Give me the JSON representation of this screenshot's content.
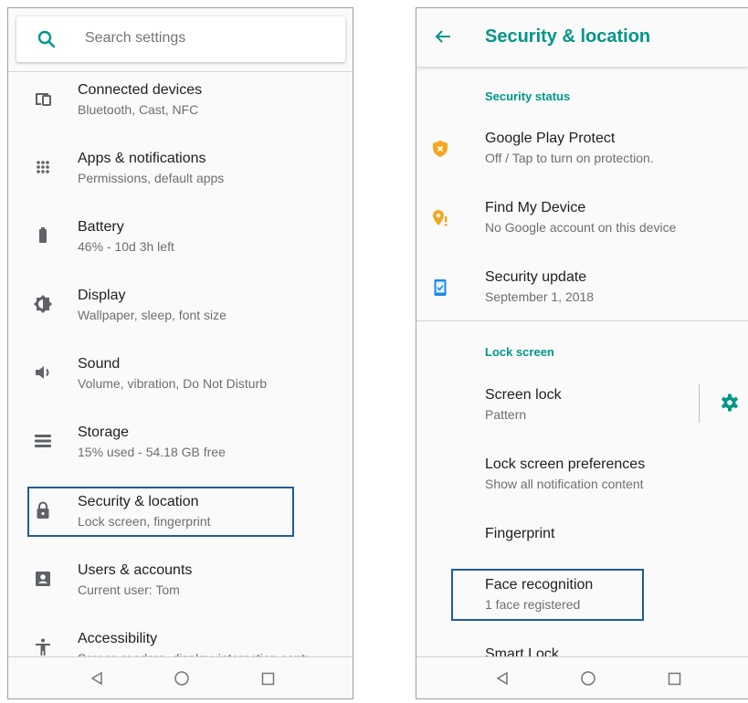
{
  "left_screen": {
    "search": {
      "placeholder": "Search settings",
      "icon": "search-icon"
    },
    "items": [
      {
        "title": "Connected devices",
        "subtitle": "Bluetooth, Cast, NFC",
        "icon": "devices-icon"
      },
      {
        "title": "Apps & notifications",
        "subtitle": "Permissions, default apps",
        "icon": "apps-grid-icon"
      },
      {
        "title": "Battery",
        "subtitle": "46% - 10d 3h left",
        "icon": "battery-icon"
      },
      {
        "title": "Display",
        "subtitle": "Wallpaper, sleep, font size",
        "icon": "brightness-icon"
      },
      {
        "title": "Sound",
        "subtitle": "Volume, vibration, Do Not Disturb",
        "icon": "volume-icon"
      },
      {
        "title": "Storage",
        "subtitle": "15% used - 54.18 GB free",
        "icon": "storage-icon"
      },
      {
        "title": "Security & location",
        "subtitle": "Lock screen, fingerprint",
        "icon": "lock-icon"
      },
      {
        "title": "Users & accounts",
        "subtitle": "Current user: Tom",
        "icon": "account-icon"
      },
      {
        "title": "Accessibility",
        "subtitle": "Screen readers, display, interaction contr...",
        "icon": "accessibility-icon"
      }
    ],
    "highlighted_item": "Security & location"
  },
  "right_screen": {
    "title": "Security & location",
    "back_icon": "back-arrow-icon",
    "sections": [
      {
        "header": "Security status",
        "items": [
          {
            "title": "Google Play Protect",
            "subtitle": "Off / Tap to turn on protection.",
            "icon": "shield-warning-icon"
          },
          {
            "title": "Find My Device",
            "subtitle": "No Google account on this device",
            "icon": "location-warning-icon"
          },
          {
            "title": "Security update",
            "subtitle": "September 1, 2018",
            "icon": "phone-check-icon"
          }
        ]
      },
      {
        "header": "Lock screen",
        "items": [
          {
            "title": "Screen lock",
            "subtitle": "Pattern",
            "icon": "gear-icon"
          },
          {
            "title": "Lock screen preferences",
            "subtitle": "Show all notification content"
          },
          {
            "title": "Fingerprint",
            "subtitle": ""
          },
          {
            "title": "Face recognition",
            "subtitle": "1 face registered"
          },
          {
            "title": "Smart Lock",
            "subtitle": ""
          }
        ]
      }
    ],
    "highlighted_item": "Face recognition"
  },
  "nav_bar": {
    "buttons": [
      "back-triangle-icon",
      "home-circle-icon",
      "recents-square-icon"
    ]
  },
  "colors": {
    "accent": "#009688",
    "highlight_border": "#1f5c99",
    "warning": "#f5a623",
    "info_blue": "#1e88e5",
    "icon_gray": "#5f6368"
  }
}
